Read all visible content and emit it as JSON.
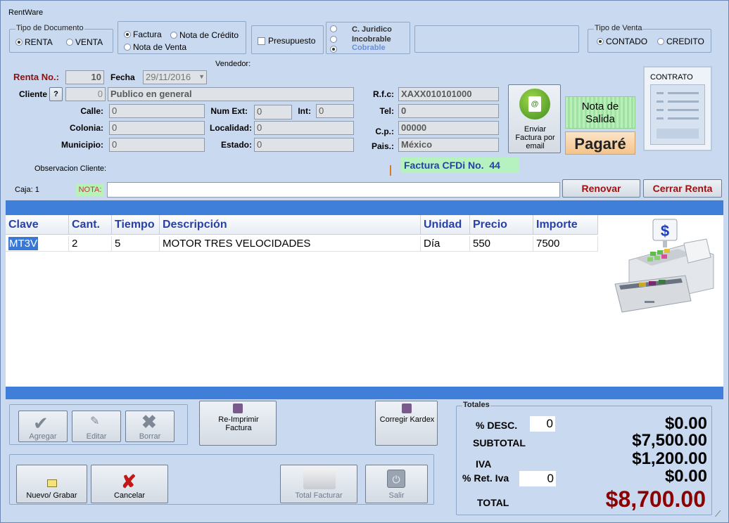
{
  "window": {
    "title": "RentWare"
  },
  "tipo_documento": {
    "label": "Tipo de Documento",
    "options": [
      "RENTA",
      "VENTA"
    ],
    "selected": "RENTA"
  },
  "doc_kind": {
    "options": [
      "Factura",
      "Nota de Crédito",
      "Nota de Venta"
    ],
    "selected": "Factura"
  },
  "presupuesto": {
    "label": "Presupuesto",
    "checked": false
  },
  "cobranza": {
    "options": [
      "C. Juridico",
      "Incobrable",
      "Cobrable"
    ],
    "selected": "Cobrable"
  },
  "tipo_venta": {
    "label": "Tipo de Venta",
    "options": [
      "CONTADO",
      "CREDITO"
    ],
    "selected": "CONTADO"
  },
  "vendedor_label": "Vendedor:",
  "renta": {
    "label": "Renta No.:",
    "value": "10"
  },
  "fecha": {
    "label": "Fecha",
    "value": "29/11/2016"
  },
  "cliente": {
    "label": "Cliente",
    "help": "?",
    "id": "0",
    "name": "Publico en general"
  },
  "address": {
    "calle": {
      "label": "Calle:",
      "value": "0"
    },
    "num_ext": {
      "label": "Num Ext:",
      "value": "0"
    },
    "int": {
      "label": "Int:",
      "value": "0"
    },
    "colonia": {
      "label": "Colonia:",
      "value": "0"
    },
    "localidad": {
      "label": "Localidad:",
      "value": "0"
    },
    "municipio": {
      "label": "Municipio:",
      "value": "0"
    },
    "estado": {
      "label": "Estado:",
      "value": "0"
    }
  },
  "fiscal": {
    "rfc": {
      "label": "R.f.c:",
      "value": "XAXX010101000"
    },
    "tel": {
      "label": "Tel:",
      "value": "0"
    },
    "cp": {
      "label": "C.p.:",
      "value": "00000"
    },
    "pais": {
      "label": "Pais.:",
      "value": "México"
    }
  },
  "email_button": {
    "label": "Enviar Factura por email"
  },
  "nota_salida": {
    "label": "Nota de Salida"
  },
  "pagare": {
    "label": "Pagaré"
  },
  "contrato": {
    "label": "CONTRATO"
  },
  "observacion_label": "Observacion Cliente:",
  "factura_cfdi": "Factura CFDi No.  44",
  "caja": "Caja: 1",
  "nota": {
    "label": "NOTA:",
    "value": ""
  },
  "renovar": "Renovar",
  "cerrar_renta": "Cerrar Renta",
  "table": {
    "headers": [
      "Clave",
      "Cant.",
      "Tiempo",
      "Descripción",
      "Unidad",
      "Precio",
      "Importe"
    ],
    "rows": [
      [
        "MT3V",
        "2",
        "5",
        "MOTOR TRES VELOCIDADES",
        "Día",
        "550",
        "7500"
      ]
    ]
  },
  "edit_buttons": {
    "agregar": "Agregar",
    "editar": "Editar",
    "borrar": "Borrar"
  },
  "reimprimir": "Re-Imprimir Factura",
  "corregir_kardex": "Corregir Kardex",
  "action_buttons": {
    "nuevo": "Nuevo/ Grabar",
    "cancelar": "Cancelar",
    "total_facturar": "Total Facturar",
    "salir": "Salir"
  },
  "totales": {
    "label": "Totales",
    "desc_label": "% DESC.",
    "desc_input": "0",
    "desc_value": "$0.00",
    "subtotal_label": "SUBTOTAL",
    "subtotal_value": "$7,500.00",
    "iva_label": "IVA",
    "iva_value": "$1,200.00",
    "ret_iva_label": "% Ret. Iva",
    "ret_iva_input": "0",
    "ret_iva_value": "$0.00",
    "total_label": "TOTAL",
    "total_value": "$8,700.00"
  },
  "colors": {
    "banner": "#3f7fd9",
    "total": "#8b0000",
    "header_text": "#2640a8",
    "renta_label": "#8b1010"
  }
}
